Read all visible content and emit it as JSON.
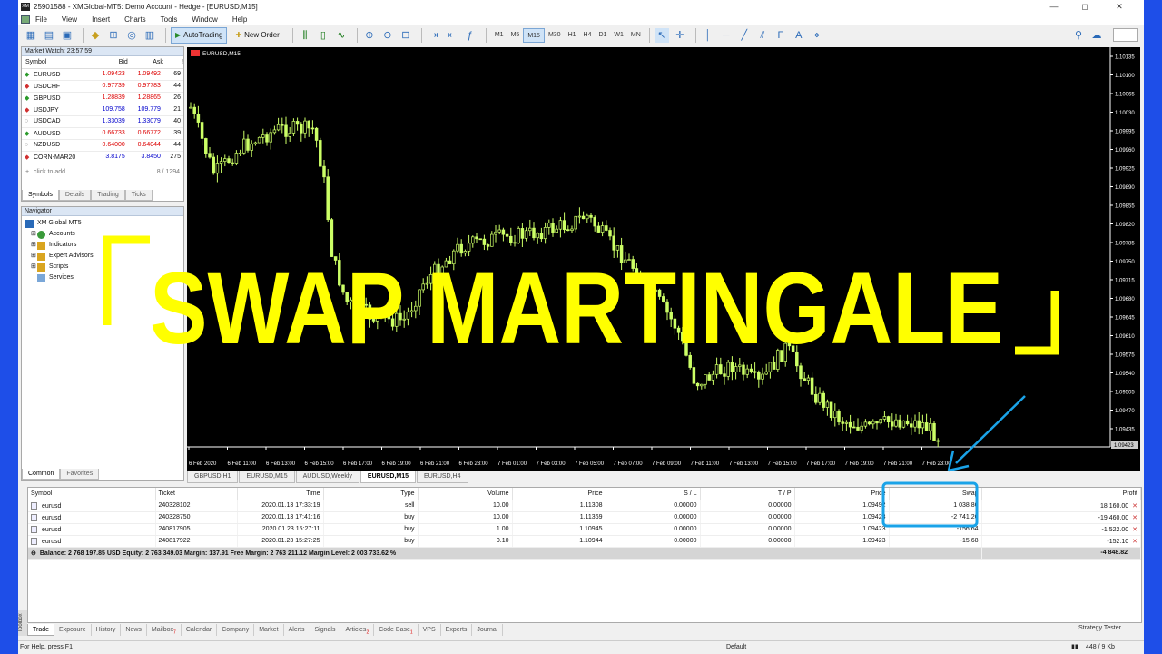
{
  "window": {
    "title": "25901588 - XMGlobal-MT5: Demo Account - Hedge - [EURUSD,M15]",
    "controls": [
      "—",
      "◻",
      "✕"
    ]
  },
  "menu": [
    "File",
    "View",
    "Insert",
    "Charts",
    "Tools",
    "Window",
    "Help"
  ],
  "toolbar": {
    "autotrading_label": "AutoTrading",
    "neworder_label": "New Order",
    "timeframes": [
      "M1",
      "M5",
      "M15",
      "M30",
      "H1",
      "H4",
      "D1",
      "W1",
      "MN"
    ],
    "active_timeframe": "M15"
  },
  "market_watch": {
    "title": "Market Watch: 23:57:59",
    "headers": [
      "Symbol",
      "Bid",
      "Ask",
      "!"
    ],
    "rows": [
      {
        "symbol": "EURUSD",
        "bid": "1.09423",
        "ask": "1.09492",
        "spread": "69",
        "dir": "up",
        "color": "red"
      },
      {
        "symbol": "USDCHF",
        "bid": "0.97739",
        "ask": "0.97783",
        "spread": "44",
        "dir": "down",
        "color": "red"
      },
      {
        "symbol": "GBPUSD",
        "bid": "1.28839",
        "ask": "1.28865",
        "spread": "26",
        "dir": "up",
        "color": "red"
      },
      {
        "symbol": "USDJPY",
        "bid": "109.758",
        "ask": "109.779",
        "spread": "21",
        "dir": "down",
        "color": "blue"
      },
      {
        "symbol": "USDCAD",
        "bid": "1.33039",
        "ask": "1.33079",
        "spread": "40",
        "dir": "none",
        "color": "blue"
      },
      {
        "symbol": "AUDUSD",
        "bid": "0.66733",
        "ask": "0.66772",
        "spread": "39",
        "dir": "up",
        "color": "red"
      },
      {
        "symbol": "NZDUSD",
        "bid": "0.64000",
        "ask": "0.64044",
        "spread": "44",
        "dir": "none",
        "color": "red"
      },
      {
        "symbol": "CORN-MAR20",
        "bid": "3.8175",
        "ask": "3.8450",
        "spread": "275",
        "dir": "down",
        "color": "blue"
      }
    ],
    "add_placeholder": "click to add...",
    "count": "8 / 1294",
    "tabs": [
      "Symbols",
      "Details",
      "Trading",
      "Ticks"
    ]
  },
  "navigator": {
    "title": "Navigator",
    "root": "XM Global MT5",
    "items": [
      "Accounts",
      "Indicators",
      "Expert Advisors",
      "Scripts",
      "Services"
    ],
    "tabs": [
      "Common",
      "Favorites"
    ]
  },
  "chart": {
    "label": "EURUSD,M15",
    "price_labels": [
      "1.10135",
      "1.10100",
      "1.10065",
      "1.10030",
      "1.09995",
      "1.09960",
      "1.09925",
      "1.09890",
      "1.09855",
      "1.09820",
      "1.09785",
      "1.09750",
      "1.09715",
      "1.09680",
      "1.09645",
      "1.09610",
      "1.09575",
      "1.09540",
      "1.09505",
      "1.09470",
      "1.09435"
    ],
    "current_price": "1.09423",
    "time_labels": [
      "6 Feb 2020",
      "6 Feb 11:00",
      "6 Feb 13:00",
      "6 Feb 15:00",
      "6 Feb 17:00",
      "6 Feb 19:00",
      "6 Feb 21:00",
      "6 Feb 23:00",
      "7 Feb 01:00",
      "7 Feb 03:00",
      "7 Feb 05:00",
      "7 Feb 07:00",
      "7 Feb 09:00",
      "7 Feb 11:00",
      "7 Feb 13:00",
      "7 Feb 15:00",
      "7 Feb 17:00",
      "7 Feb 19:00",
      "7 Feb 21:00",
      "7 Feb 23:00"
    ],
    "tabs": [
      "GBPUSD,H1",
      "EURUSD,M15",
      "AUDUSD,Weekly",
      "EURUSD,M15",
      "EURUSD,H4"
    ],
    "active_tab": 3,
    "overlay_text": "SWAP MARTINGALE",
    "overlay_bracket_left": "「",
    "overlay_bracket_right": "」",
    "candle_color": "#ccff66"
  },
  "trade": {
    "headers": [
      "Symbol",
      "Ticket",
      "Time",
      "Type",
      "Volume",
      "Price",
      "S / L",
      "T / P",
      "Price",
      "Swap",
      "Profit"
    ],
    "rows": [
      {
        "symbol": "eurusd",
        "ticket": "240328102",
        "time": "2020.01.13 17:33:19",
        "type": "sell",
        "volume": "10.00",
        "price": "1.11308",
        "sl": "0.00000",
        "tp": "0.00000",
        "cur": "1.09492",
        "swap": "1 038.80",
        "profit": "18 160.00"
      },
      {
        "symbol": "eurusd",
        "ticket": "240328750",
        "time": "2020.01.13 17:41:16",
        "type": "buy",
        "volume": "10.00",
        "price": "1.11369",
        "sl": "0.00000",
        "tp": "0.00000",
        "cur": "1.09423",
        "swap": "-2 741.20",
        "profit": "-19 460.00"
      },
      {
        "symbol": "eurusd",
        "ticket": "240817905",
        "time": "2020.01.23 15:27:11",
        "type": "buy",
        "volume": "1.00",
        "price": "1.10945",
        "sl": "0.00000",
        "tp": "0.00000",
        "cur": "1.09423",
        "swap": "-156.64",
        "profit": "-1 522.00"
      },
      {
        "symbol": "eurusd",
        "ticket": "240817922",
        "time": "2020.01.23 15:27:25",
        "type": "buy",
        "volume": "0.10",
        "price": "1.10944",
        "sl": "0.00000",
        "tp": "0.00000",
        "cur": "1.09423",
        "swap": "-15.68",
        "profit": "-152.10"
      }
    ],
    "balance_line": "Balance: 2 768 197.85 USD  Equity: 2 763 349.03  Margin: 137.91  Free Margin: 2 763 211.12  Margin Level: 2 003 733.62 %",
    "total_profit": "-4 848.82"
  },
  "toolbox": {
    "label": "Toolbox",
    "tabs": [
      {
        "label": "Trade",
        "badge": ""
      },
      {
        "label": "Exposure",
        "badge": ""
      },
      {
        "label": "History",
        "badge": ""
      },
      {
        "label": "News",
        "badge": ""
      },
      {
        "label": "Mailbox",
        "badge": "7"
      },
      {
        "label": "Calendar",
        "badge": ""
      },
      {
        "label": "Company",
        "badge": ""
      },
      {
        "label": "Market",
        "badge": ""
      },
      {
        "label": "Alerts",
        "badge": ""
      },
      {
        "label": "Signals",
        "badge": ""
      },
      {
        "label": "Articles",
        "badge": "2"
      },
      {
        "label": "Code Base",
        "badge": "1"
      },
      {
        "label": "VPS",
        "badge": ""
      },
      {
        "label": "Experts",
        "badge": ""
      },
      {
        "label": "Journal",
        "badge": ""
      }
    ],
    "strategy_tester": "Strategy Tester"
  },
  "status": {
    "help": "For Help, press F1",
    "profile": "Default",
    "traffic": "448 / 9 Kb"
  },
  "colors": {
    "overlay_yellow": "#ffff00",
    "highlight_blue": "#1aa3e8",
    "frame_blue": "#1e4ee8"
  }
}
